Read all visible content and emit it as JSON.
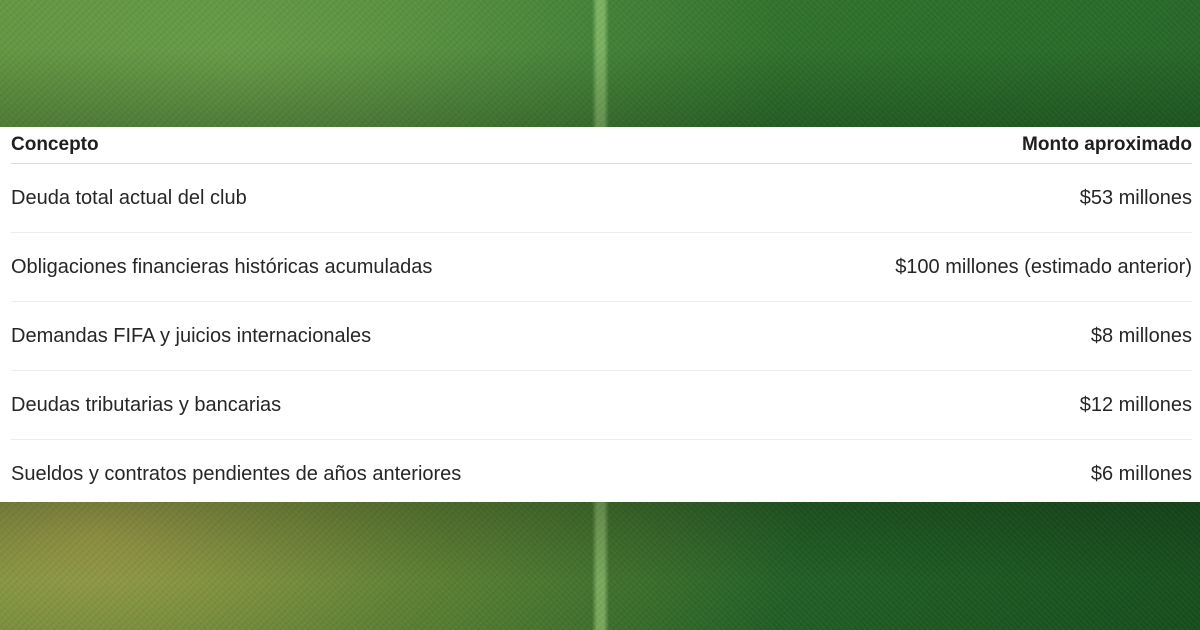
{
  "table": {
    "headers": {
      "concept": "Concepto",
      "amount": "Monto aproximado"
    },
    "rows": [
      {
        "concept": "Deuda total actual del club",
        "amount": "$53 millones"
      },
      {
        "concept": "Obligaciones financieras históricas acumuladas",
        "amount": "$100 millones (estimado anterior)"
      },
      {
        "concept": "Demandas FIFA y juicios internacionales",
        "amount": "$8 millones"
      },
      {
        "concept": "Deudas tributarias y bancarias",
        "amount": "$12 millones"
      },
      {
        "concept": "Sueldos y contratos pendientes de años anteriores",
        "amount": "$6 millones"
      }
    ]
  },
  "colors": {
    "background_green": "#2f6e31",
    "panel": "#ffffff",
    "text": "#262626"
  }
}
